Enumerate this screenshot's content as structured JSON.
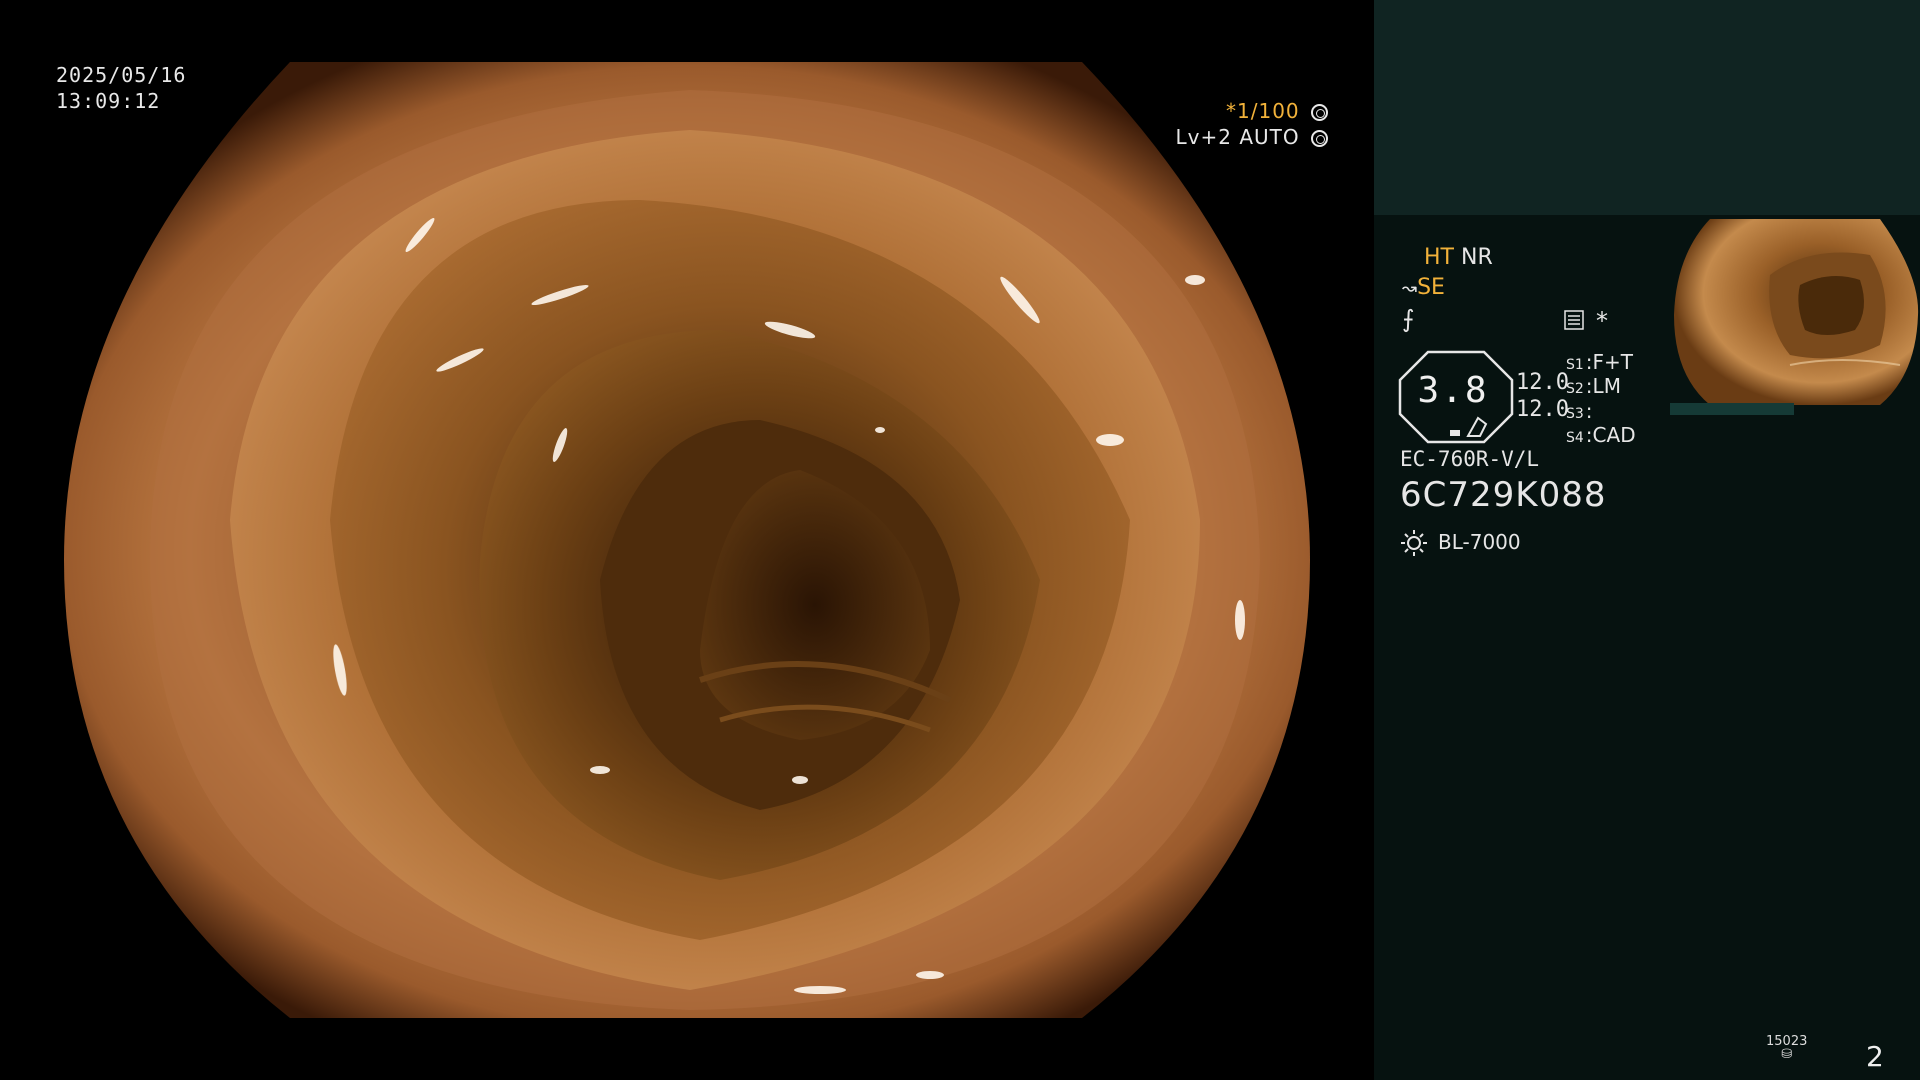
{
  "osd": {
    "date": "2025/05/16",
    "time": "13:09:12",
    "shutter": "*1/100",
    "brightness": "Lv+2",
    "exposure": "AUTO"
  },
  "panel": {
    "ht_label": "HT",
    "nr_label": "NR",
    "se_label": "SE",
    "filter_symbol": "⨍",
    "asterisk": "*",
    "zoom_value": "3.8",
    "zoom_a": "12.0",
    "zoom_b": "12.0",
    "switches": [
      {
        "key": "S1",
        "value": "F+T"
      },
      {
        "key": "S2",
        "value": "LM"
      },
      {
        "key": "S3",
        "value": ""
      },
      {
        "key": "S4",
        "value": "CAD"
      }
    ],
    "scope_model": "EC-760R-V/L",
    "serial_number": "6C729K088",
    "light_source": "BL-7000"
  },
  "footer": {
    "counter": "15023",
    "page_number": "2"
  },
  "colors": {
    "accent_yellow": "#f2b23a",
    "panel_top": "#102422",
    "panel_bottom": "#061210"
  },
  "icons": {
    "shutter": "aperture-icon",
    "exposure": "auto-iris-icon",
    "light": "lamp-icon"
  }
}
